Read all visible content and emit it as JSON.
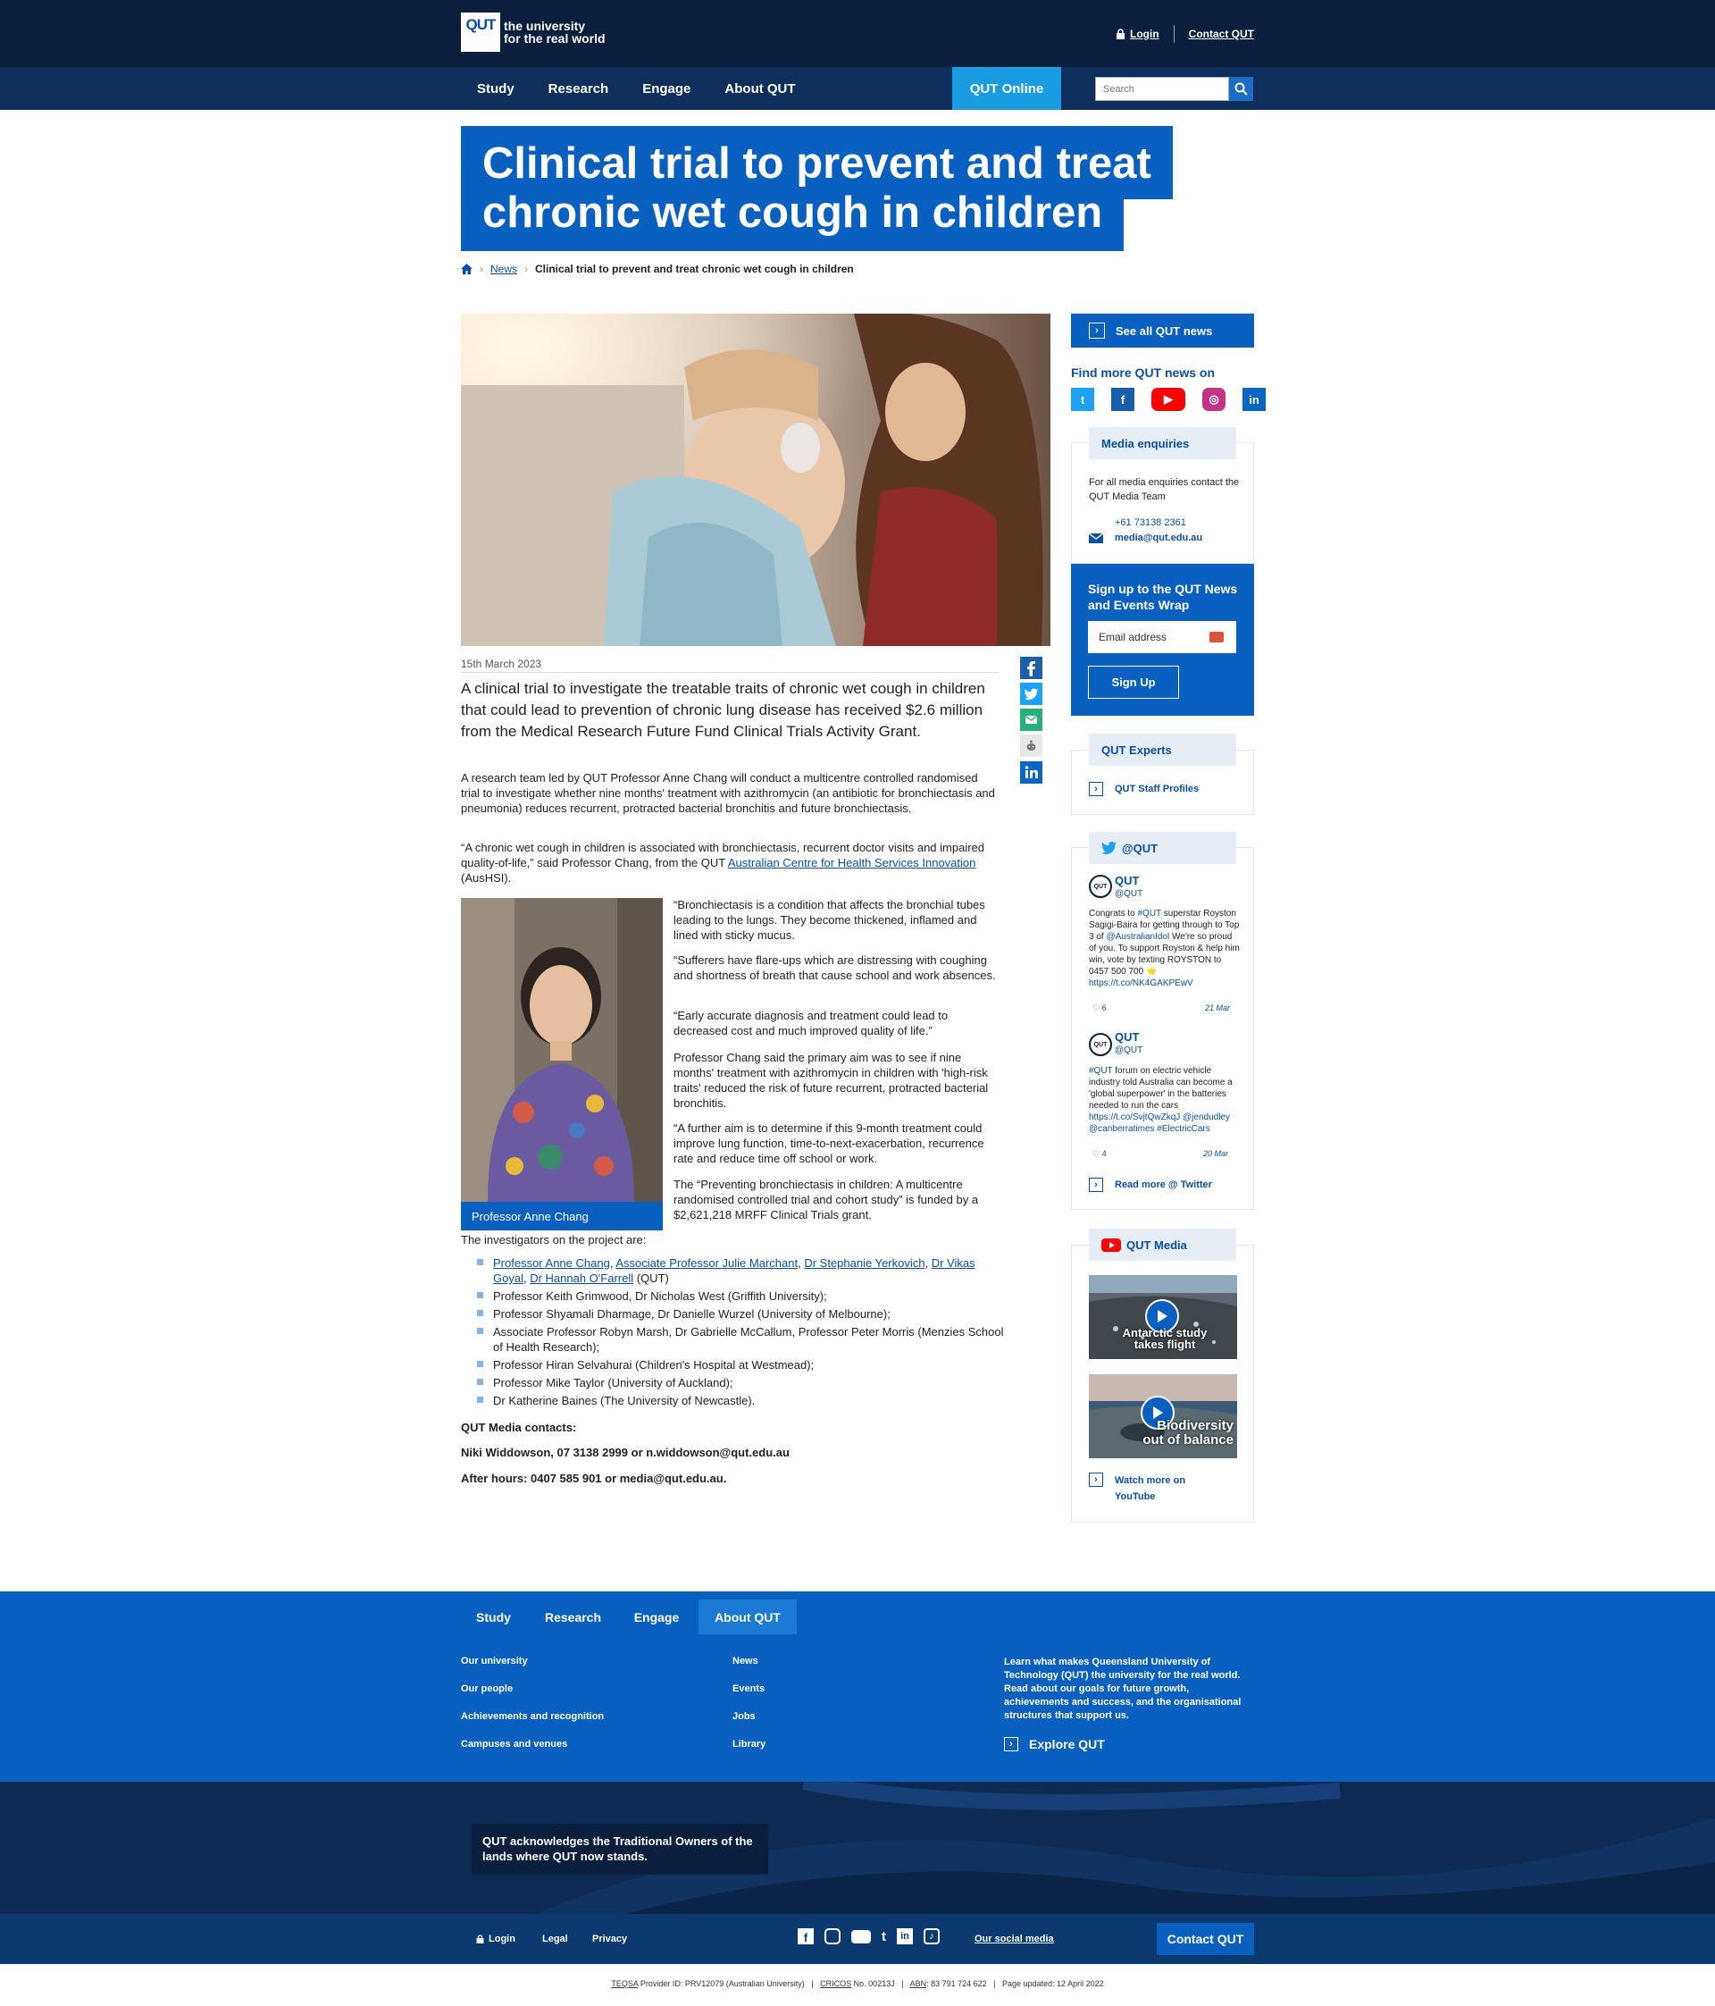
{
  "header": {
    "logo_mark": "QUT",
    "logo_line1": "the university",
    "logo_line2": "for the real world",
    "login": "Login",
    "contact": "Contact QUT",
    "nav": [
      "Study",
      "Research",
      "Engage",
      "About QUT"
    ],
    "qut_online": "QUT Online",
    "search_placeholder": "Search"
  },
  "article": {
    "title_line1": "Clinical trial to prevent and treat",
    "title_line2": "chronic wet cough in children",
    "breadcrumb_news": "News",
    "breadcrumb_current": "Clinical trial to prevent and treat chronic wet cough in children",
    "date": "15th March 2023",
    "lead": "A clinical trial to investigate the treatable traits of chronic wet cough in children that could lead to prevention of chronic lung disease has received $2.6 million from the Medical Research Future Fund Clinical Trials Activity Grant.",
    "p1": "A research team led by QUT Professor Anne Chang will conduct a multicentre controlled randomised trial to investigate whether nine months' treatment with azithromycin (an antibiotic for bronchiectasis and pneumonia) reduces recurrent, protracted bacterial bronchitis and future bronchiectasis.",
    "p2_start": "“A chronic wet cough in children is associated with bronchiectasis, recurrent doctor visits and impaired quality-of-life,” said Professor Chang, from the QUT ",
    "p2_link": "Australian Centre for Health Services Innovation",
    "p2_end": " (AusHSI).",
    "caption": "Professor Anne Chang",
    "q1": "“Bronchiectasis is a condition that affects the bronchial tubes leading to the lungs. They become thickened, inflamed and lined with sticky mucus.",
    "q2": "“Sufferers have flare-ups which are distressing with coughing and shortness of breath that cause school and work absences.",
    "q3": "“Early accurate diagnosis and treatment could lead to decreased cost and much improved quality of life.”",
    "q4": "Professor Chang said the primary aim was to see if nine months' treatment with azithromycin in children with 'high-risk traits' reduced the risk of future recurrent, protracted bacterial bronchitis.",
    "q5": "“A further aim is to determine if this 9-month treatment could improve lung function, time-to-next-exacerbation, recurrence rate and reduce time off school or work.",
    "q6": "The “Preventing bronchiectasis in children: A multicentre randomised controlled trial and cohort study” is funded by a $2,621,218 MRFF Clinical Trials grant.",
    "investigators_intro": "The investigators on the project are:",
    "inv_links": [
      "Professor Anne Chang",
      "Associate Professor Julie Marchant",
      "Dr Stephanie Yerkovich",
      "Dr Vikas Goyal",
      "Dr Hannah O'Farrell"
    ],
    "inv_links_suffix": " (QUT)",
    "investigators": [
      "Professor Keith Grimwood, Dr Nicholas West (Griffith University);",
      "Professor Shyamali Dharmage, Dr Danielle Wurzel (University of Melbourne);",
      "Associate Professor Robyn Marsh, Dr Gabrielle McCallum, Professor Peter Morris (Menzies School of Health Research);",
      "Professor Hiran Selvahurai (Children's Hospital at Westmead);",
      "Professor Mike Taylor (University of Auckland);",
      "Dr Katherine Baines (The University of Newcastle)."
    ],
    "media_contacts": "QUT Media contacts:",
    "media_line1": "Niki Widdowson, 07 3138 2999 or n.widdowson@qut.edu.au",
    "media_line2": "After hours: 0407 585 901 or media@qut.edu.au."
  },
  "sidebar": {
    "see_all": "See all QUT news",
    "find_more": "Find more QUT news on",
    "media_title": "Media enquiries",
    "media_text": "For all media enquiries contact the QUT Media Team",
    "media_phone": "+61 73138 2361",
    "media_email": "media@qut.edu.au",
    "signup_title": "Sign up to the QUT News and Events Wrap",
    "email_placeholder": "Email address",
    "signup_button": "Sign Up",
    "experts_title": "QUT Experts",
    "experts_link": "QUT Staff Profiles",
    "twitter_title": "@QUT",
    "tweets": [
      {
        "name": "QUT",
        "handle": "@QUT",
        "text_a": "Congrats to ",
        "tag_a": "#QUT",
        "text_b": " superstar Royston Sagigi-Baira for getting through to Top 3 of ",
        "tag_b": "@AustralianIdol",
        "text_c": " We're so proud of you. To support Royston & help him win, vote by texting ROYSTON to 0457 500 700 ⭐ ",
        "url": "https://t.co/NK4GAKPEwV",
        "likes": "6",
        "date": "21 Mar"
      },
      {
        "name": "QUT",
        "handle": "@QUT",
        "text_a": "",
        "tag_a": "#QUT",
        "text_b": " forum on electric vehicle industry told Australia can become a 'global superpower' in the batteries needed to run the cars ",
        "tag_b": "https://t.co/SvjtQwZkqJ @jendudley @canberratimes #ElectricCars",
        "text_c": "",
        "url": "",
        "likes": "4",
        "date": "20 Mar"
      }
    ],
    "twitter_more": "Read more @ Twitter",
    "media_section": "QUT Media",
    "video1_title": "Antarctic study takes flight",
    "video2_title": "Biodiversity out of balance",
    "watch_more": "Watch more on YouTube"
  },
  "footer": {
    "tabs": [
      "Study",
      "Research",
      "Engage",
      "About QUT"
    ],
    "col1": [
      "Our university",
      "Our people",
      "Achievements and recognition",
      "Campuses and venues"
    ],
    "col2": [
      "News",
      "Events",
      "Jobs",
      "Library"
    ],
    "about_text": "Learn what makes Queensland University of Technology (QUT) the university for the real world. Read about our goals for future growth, achievements and success, and the organisational structures that support us.",
    "explore": "Explore QUT",
    "acknowledgement": "QUT acknowledges the Traditional Owners of the lands where QUT now stands.",
    "login": "Login",
    "legal": "Legal",
    "privacy": "Privacy",
    "social": "Our social media",
    "contact": "Contact QUT",
    "fine_teqsa": "TEQSA",
    "fine_teqsa_val": " Provider ID: PRV12079 (Australian University)",
    "fine_cricos": "CRICOS",
    "fine_cricos_val": " No. 00213J",
    "fine_abn": "ABN",
    "fine_abn_val": ": 83 791 724 622",
    "fine_updated": "Page updated: 12 April 2022"
  },
  "colors": {
    "navy": "#0a1f3d",
    "brand_blue": "#0a60bf",
    "accent_cyan": "#1a9de0"
  }
}
